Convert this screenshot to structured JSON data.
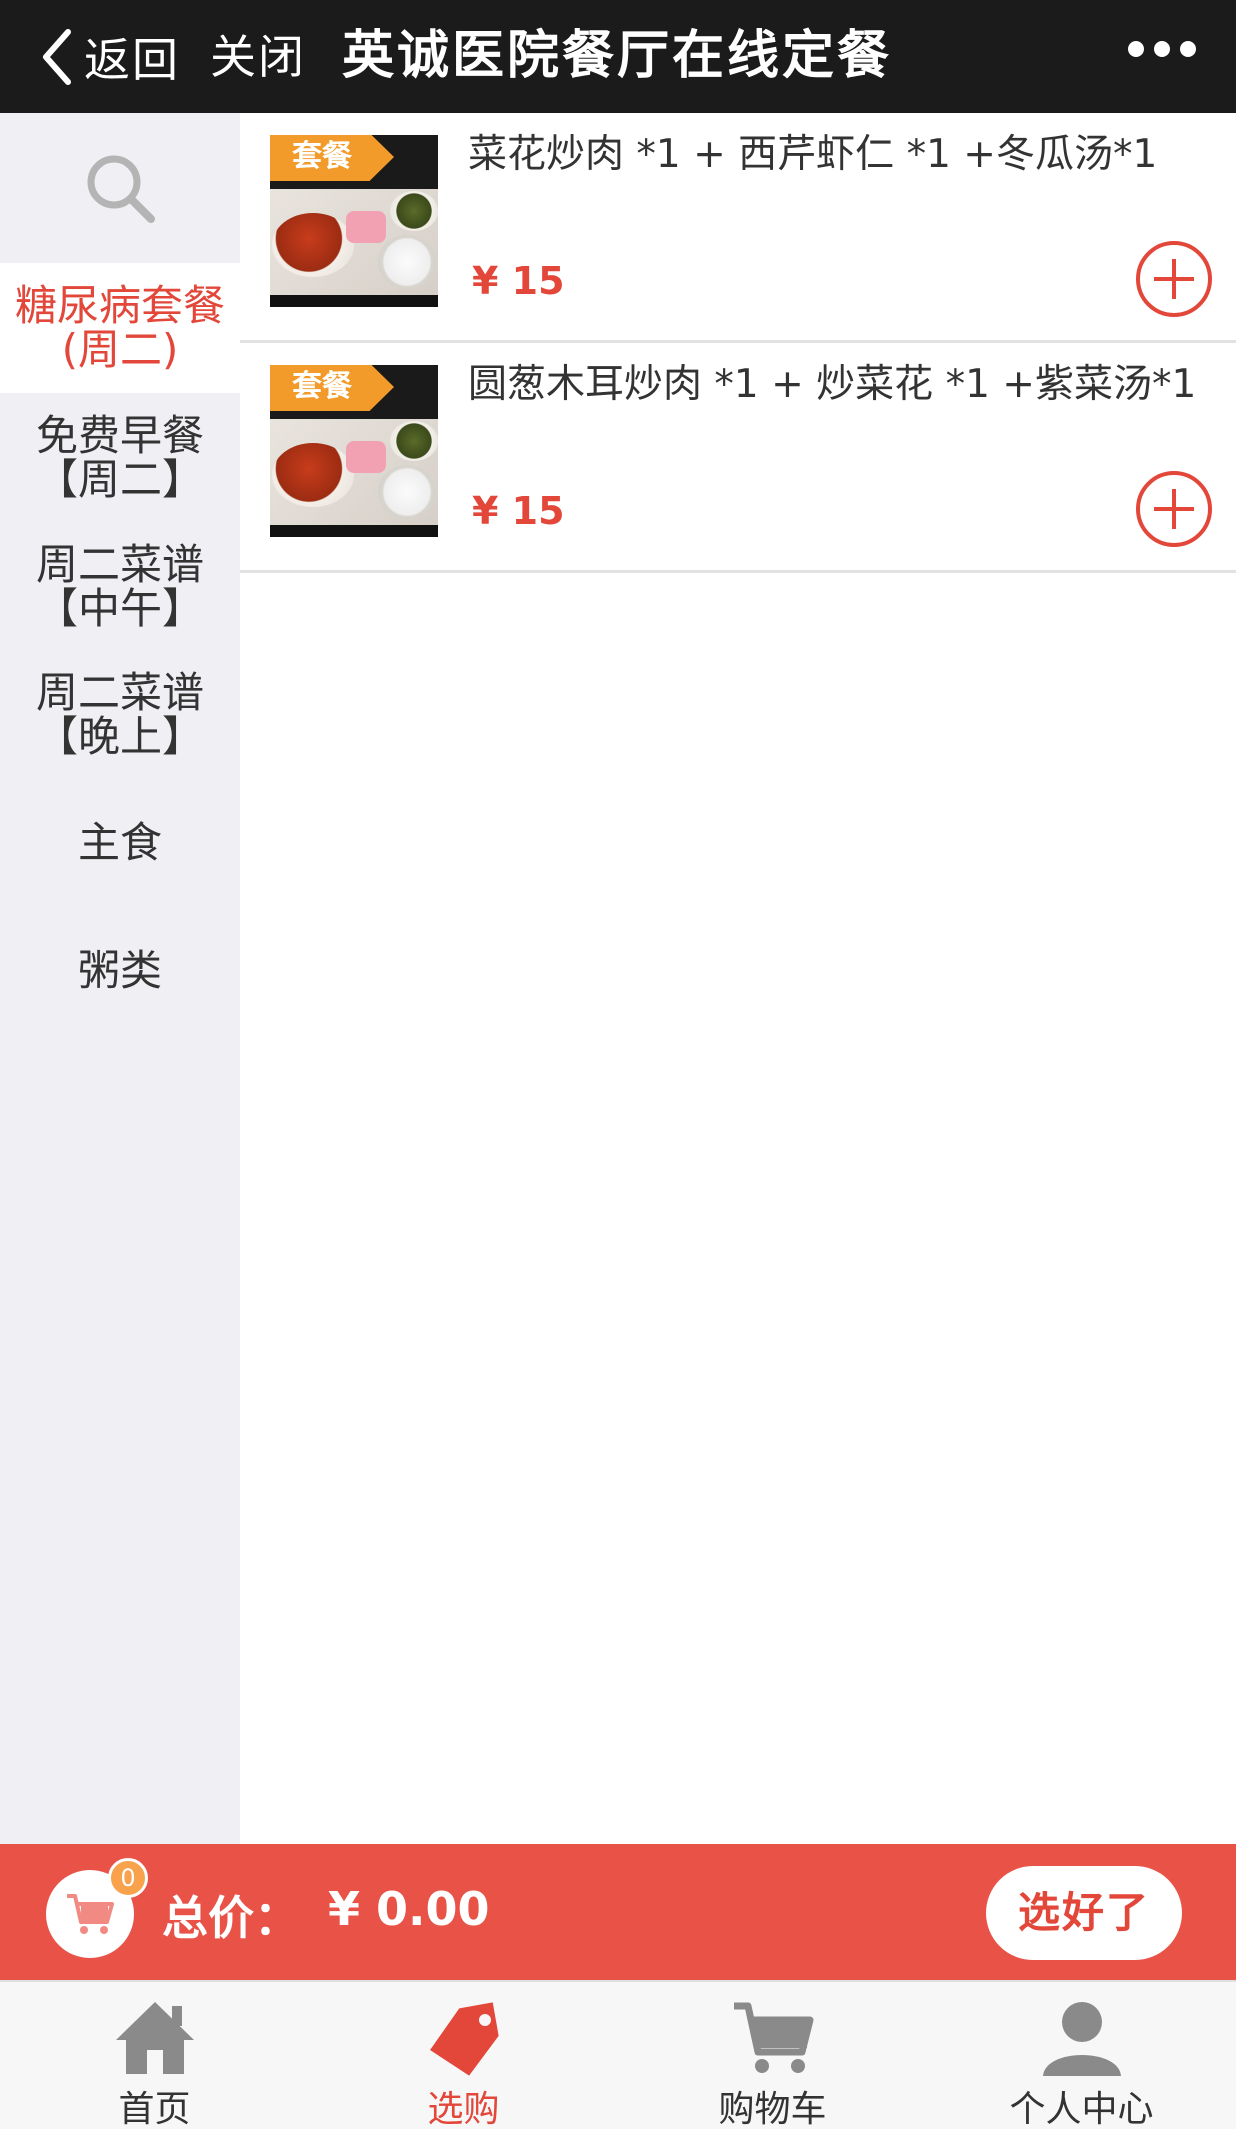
{
  "header": {
    "back_label": "返回",
    "close_label": "关闭",
    "title": "英诚医院餐厅在线定餐"
  },
  "sidebar": {
    "search_icon": "search-icon",
    "categories": [
      {
        "label": "糖尿病套餐\n(周二)",
        "active": true
      },
      {
        "label": "免费早餐\n【周二】",
        "active": false
      },
      {
        "label": "周二菜谱\n【中午】",
        "active": false
      },
      {
        "label": "周二菜谱\n【晚上】",
        "active": false
      },
      {
        "label": "主食",
        "active": false
      },
      {
        "label": "粥类",
        "active": false
      }
    ]
  },
  "products": [
    {
      "tag": "套餐",
      "name": "菜花炒肉 *1 + 西芹虾仁 *1 +冬瓜汤*1",
      "price": "¥ 15"
    },
    {
      "tag": "套餐",
      "name": "圆葱木耳炒肉 *1 + 炒菜花 *1 +紫菜汤*1",
      "price": "¥ 15"
    }
  ],
  "cart": {
    "badge_count": "0",
    "total_label": "总价：",
    "total_value": "¥ 0.00",
    "checkout_label": "选好了"
  },
  "nav": {
    "items": [
      {
        "label": "首页",
        "icon": "home-icon",
        "active": false
      },
      {
        "label": "选购",
        "icon": "tag-icon",
        "active": true
      },
      {
        "label": "购物车",
        "icon": "cart-icon",
        "active": false
      },
      {
        "label": "个人中心",
        "icon": "user-icon",
        "active": false
      }
    ]
  },
  "colors": {
    "accent": "#e2473a",
    "header_bg": "#1b1b1b",
    "cartbar_bg": "#e85247",
    "tag_bg": "#f29b2a",
    "sidebar_bg": "#f0eff4"
  }
}
